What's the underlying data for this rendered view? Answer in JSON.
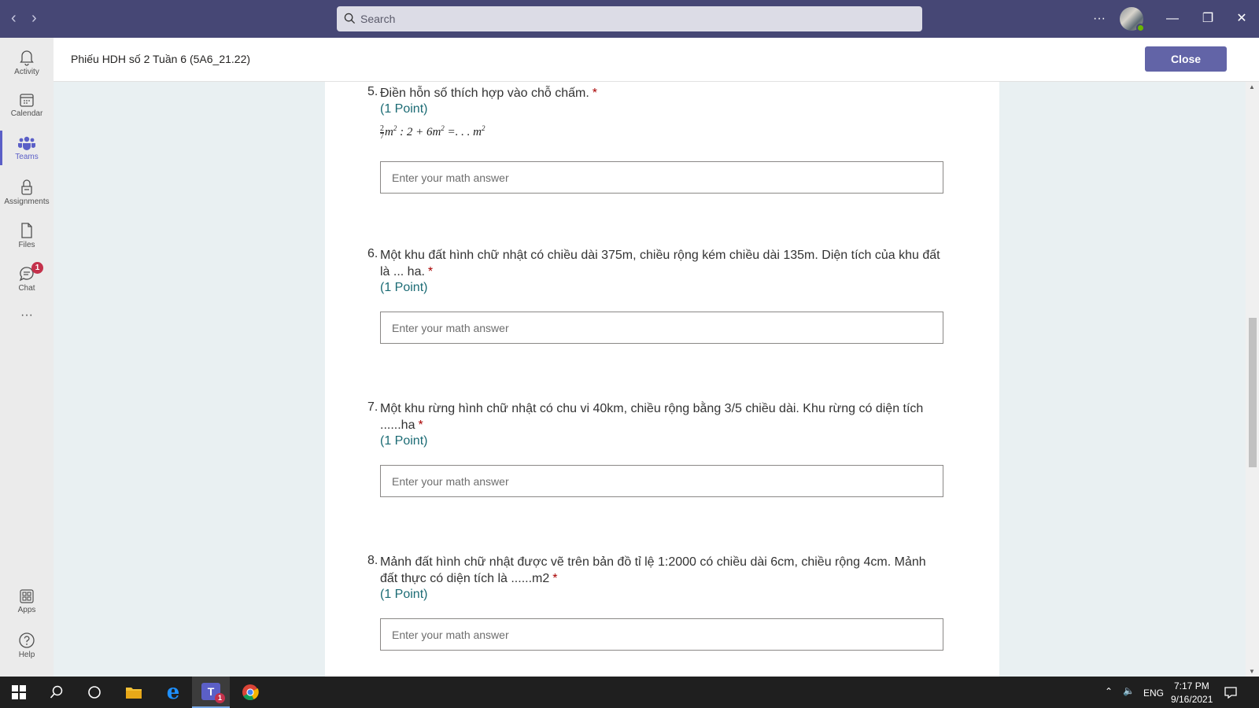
{
  "titlebar": {
    "search_placeholder": "Search",
    "more_label": "···",
    "minimize_label": "—",
    "restore_label": "❐",
    "close_label": "✕"
  },
  "rail": {
    "items": [
      {
        "label": "Activity",
        "icon": "bell-icon"
      },
      {
        "label": "Calendar",
        "icon": "calendar-icon"
      },
      {
        "label": "Teams",
        "icon": "teams-icon",
        "active": true
      },
      {
        "label": "Assignments",
        "icon": "assignments-icon"
      },
      {
        "label": "Files",
        "icon": "file-icon"
      },
      {
        "label": "Chat",
        "icon": "chat-icon",
        "badge": "1"
      },
      {
        "label": "···",
        "icon": "more-icon"
      },
      {
        "label": "Apps",
        "icon": "apps-icon"
      },
      {
        "label": "Help",
        "icon": "help-icon"
      }
    ]
  },
  "header": {
    "title": "Phiếu HDH số 2 Tuần 6 (5A6_21.22)",
    "close_button": "Close"
  },
  "form": {
    "questions": [
      {
        "number": "5.",
        "text": "Điền hỗn số thích hợp vào chỗ chấm.",
        "required": "*",
        "points": "(1 Point)",
        "formula": {
          "frac_num": "2",
          "frac_den": "7",
          "rest_1": "m",
          "exp": "2",
          "rest_2": " : 2  + 6m",
          "rest_3": "  =. . .  m"
        },
        "placeholder": "Enter your math answer"
      },
      {
        "number": "6.",
        "text": "Một khu đất hình chữ nhật có chiều dài 375m, chiều rộng kém chiều dài 135m. Diện tích của khu đất là ... ha.",
        "required": "*",
        "points": "(1 Point)",
        "placeholder": "Enter your math answer"
      },
      {
        "number": "7.",
        "text": "Một khu rừng hình chữ nhật có chu vi 40km, chiều rộng bằng 3/5 chiều dài. Khu rừng có diện tích ......ha",
        "required": "*",
        "points": "(1 Point)",
        "placeholder": "Enter your math answer"
      },
      {
        "number": "8.",
        "text": "Mảnh đất hình chữ nhật được vẽ trên bản đồ tỉ lệ 1:2000 có chiều dài 6cm, chiều rộng 4cm. Mảnh đất thực có diện tích là ......m2",
        "required": "*",
        "points": "(1 Point)",
        "placeholder": "Enter your math answer"
      }
    ]
  },
  "taskbar": {
    "tray": {
      "language": "ENG",
      "time": "7:17 PM",
      "date": "9/16/2021",
      "teams_badge": "1"
    }
  },
  "colors": {
    "titlebar": "#464775",
    "accent": "#6264a7",
    "points": "#1b6b74",
    "required": "#a80000"
  }
}
